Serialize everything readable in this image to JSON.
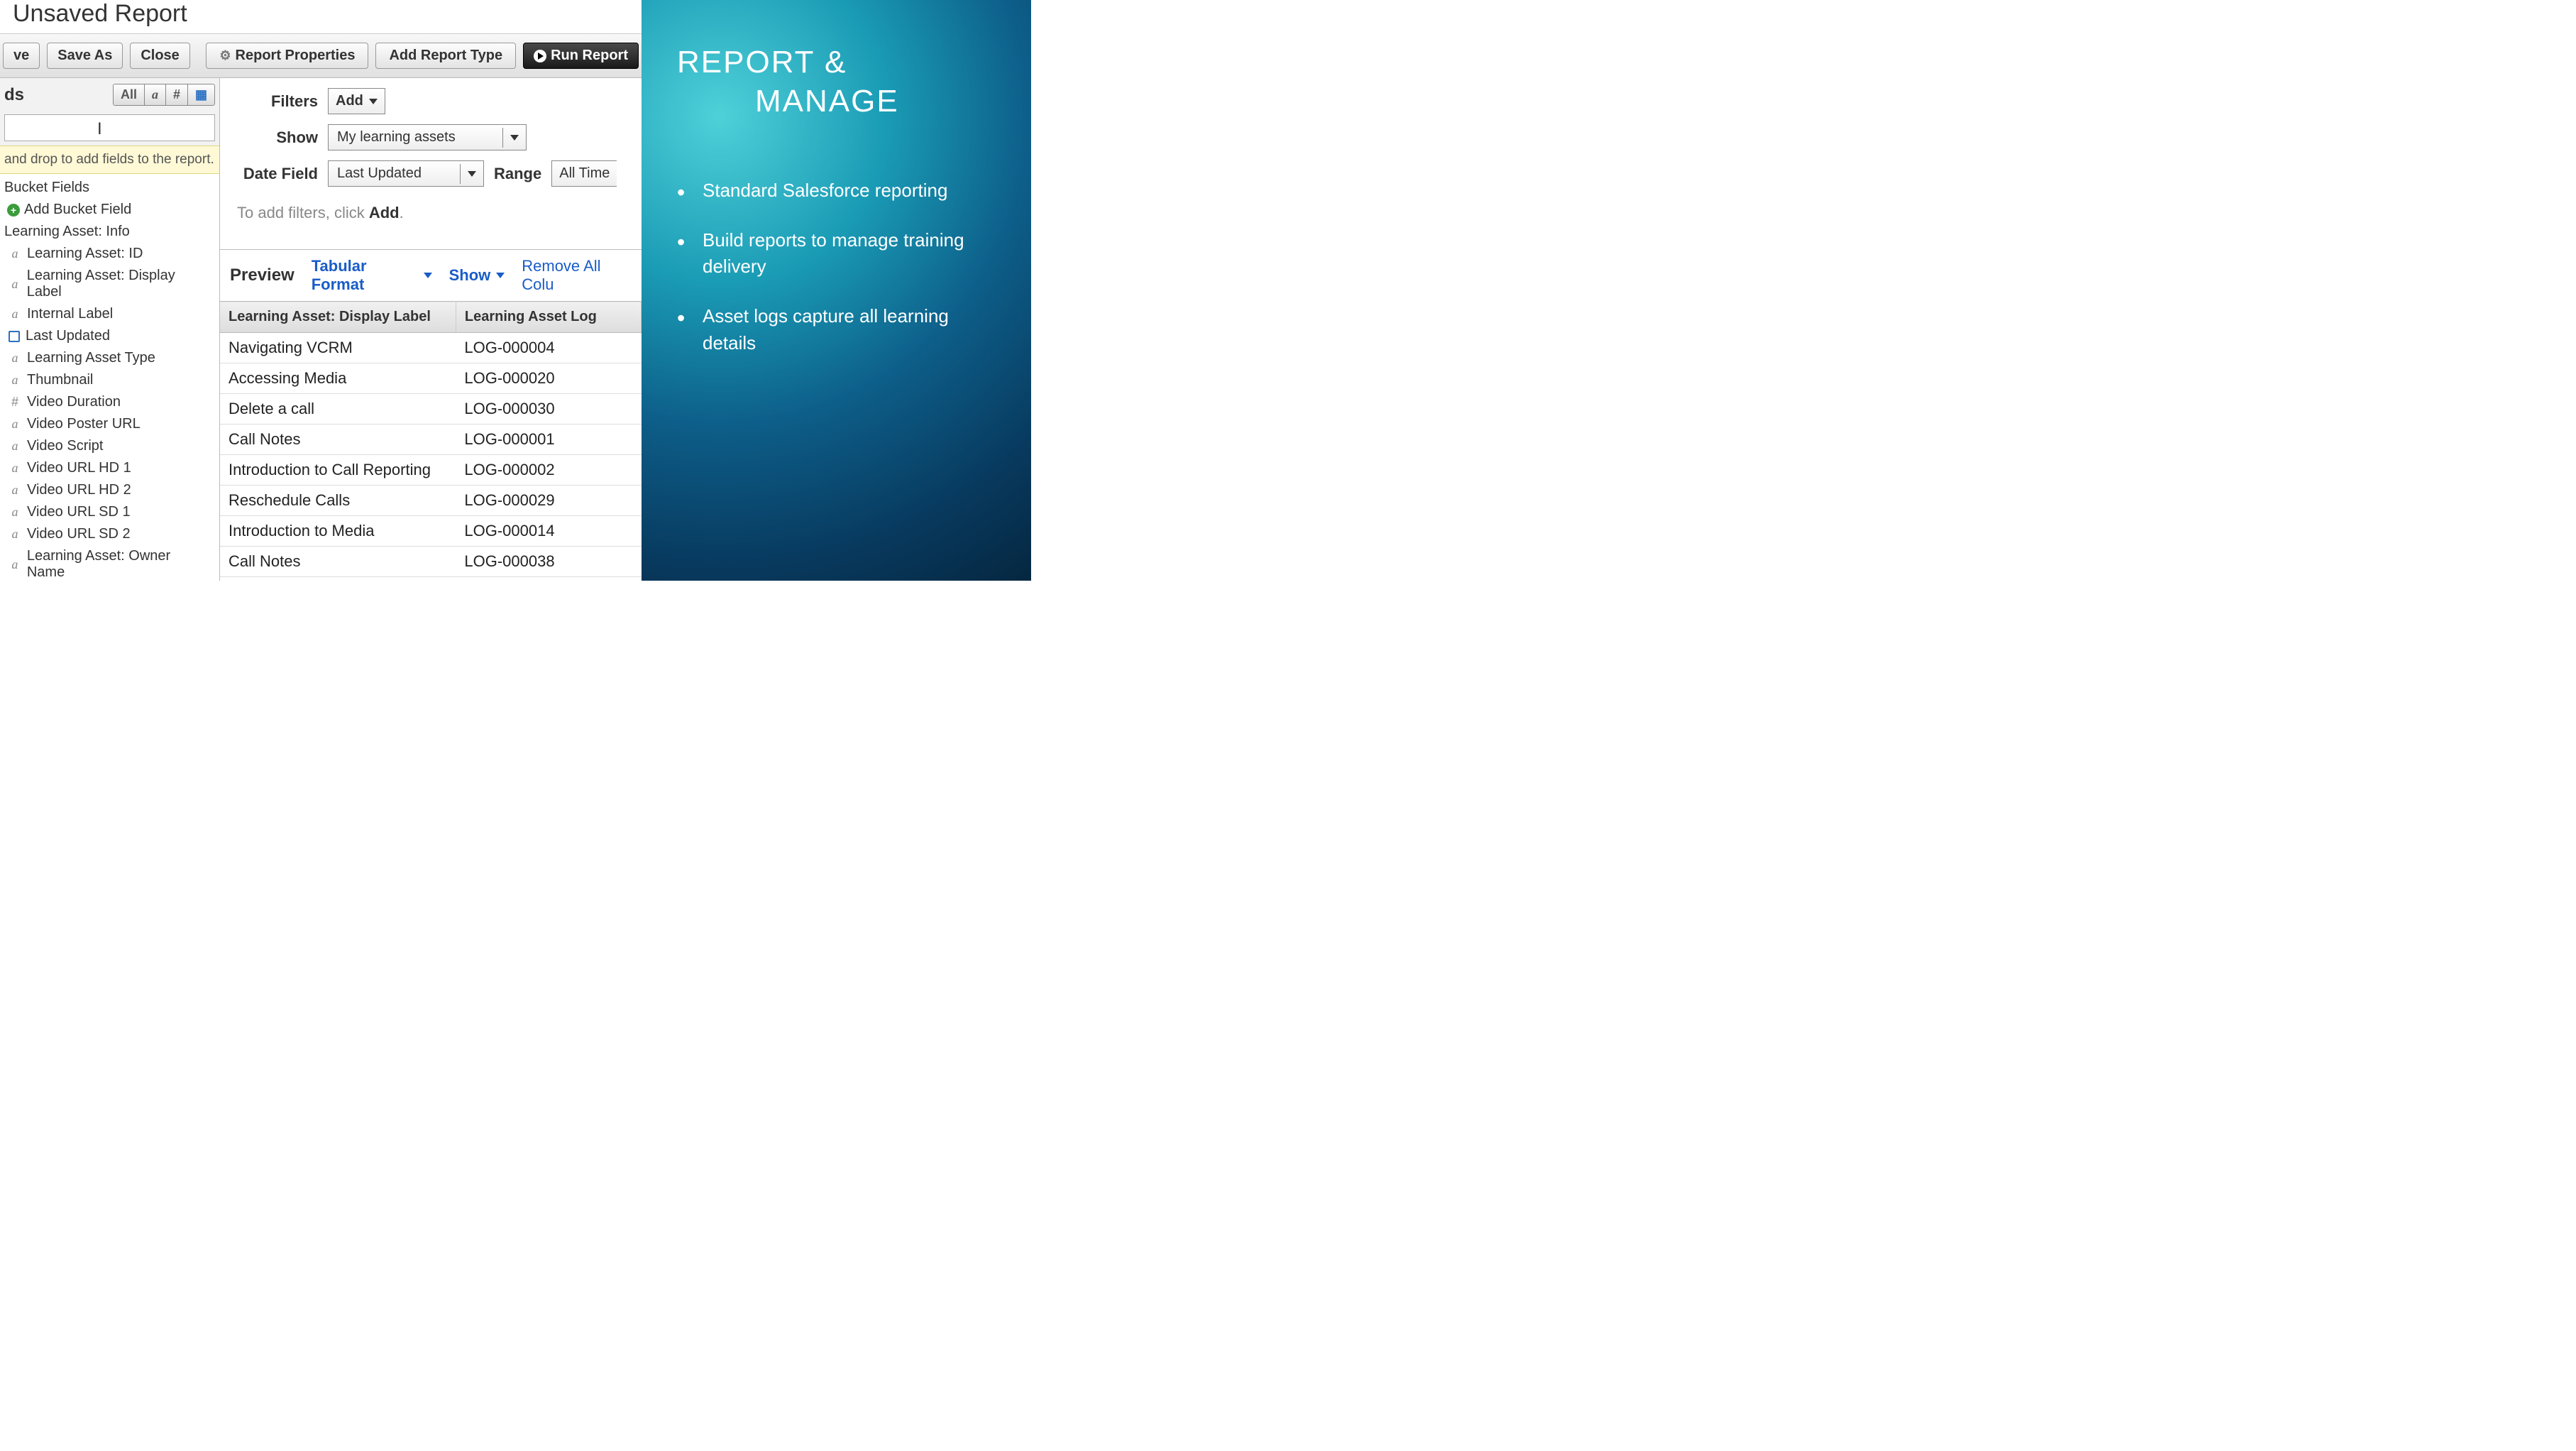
{
  "report": {
    "title": "Unsaved Report",
    "toolbar": {
      "save": "ve",
      "saveAs": "Save As",
      "close": "Close",
      "properties": "Report Properties",
      "addType": "Add Report Type",
      "run": "Run Report"
    }
  },
  "sidebar": {
    "headerLabel": "ds",
    "filterTab_all": "All",
    "filterTab_a": "a",
    "filterTab_hash": "#",
    "hint": "and drop to add fields to the report.",
    "bucketHeader": "Bucket Fields",
    "addBucket": "Add Bucket Field",
    "groupHeader": "Learning Asset: Info",
    "fields": [
      {
        "type": "a",
        "label": "Learning Asset: ID"
      },
      {
        "type": "a",
        "label": "Learning Asset: Display Label"
      },
      {
        "type": "a",
        "label": "Internal Label"
      },
      {
        "type": "cal",
        "label": "Last Updated"
      },
      {
        "type": "a",
        "label": "Learning Asset Type"
      },
      {
        "type": "a",
        "label": "Thumbnail"
      },
      {
        "type": "hash",
        "label": "Video Duration"
      },
      {
        "type": "a",
        "label": "Video Poster URL"
      },
      {
        "type": "a",
        "label": "Video Script"
      },
      {
        "type": "a",
        "label": "Video URL HD 1"
      },
      {
        "type": "a",
        "label": "Video URL HD 2"
      },
      {
        "type": "a",
        "label": "Video URL SD 1"
      },
      {
        "type": "a",
        "label": "Video URL SD 2"
      },
      {
        "type": "a",
        "label": "Learning Asset: Owner Name"
      }
    ]
  },
  "filters": {
    "filtersLabel": "Filters",
    "add": "Add",
    "showLabel": "Show",
    "showValue": "My learning assets",
    "dateFieldLabel": "Date Field",
    "dateFieldValue": "Last Updated",
    "rangeLabel": "Range",
    "rangeValue": "All Time",
    "hintPrefix": "To add filters, click ",
    "hintBold": "Add",
    "hintSuffix": "."
  },
  "preview": {
    "label": "Preview",
    "format": "Tabular Format",
    "show": "Show",
    "removeAll": "Remove All Colu",
    "columns": [
      "Learning Asset: Display Label",
      "Learning Asset Log"
    ],
    "rows": [
      {
        "label": "Navigating VCRM",
        "log": "LOG-000004"
      },
      {
        "label": "Accessing Media",
        "log": "LOG-000020"
      },
      {
        "label": "Delete a call",
        "log": "LOG-000030"
      },
      {
        "label": "Call Notes",
        "log": "LOG-000001"
      },
      {
        "label": "Introduction to Call Reporting",
        "log": "LOG-000002"
      },
      {
        "label": "Reschedule Calls",
        "log": "LOG-000029"
      },
      {
        "label": "Introduction to Media",
        "log": "LOG-000014"
      },
      {
        "label": "Call Notes",
        "log": "LOG-000038"
      }
    ]
  },
  "slide": {
    "title1": "REPORT &",
    "title2": "MANAGE",
    "bullets": [
      "Standard Salesforce reporting",
      "Build reports to manage training delivery",
      "Asset logs capture all learning details"
    ]
  }
}
